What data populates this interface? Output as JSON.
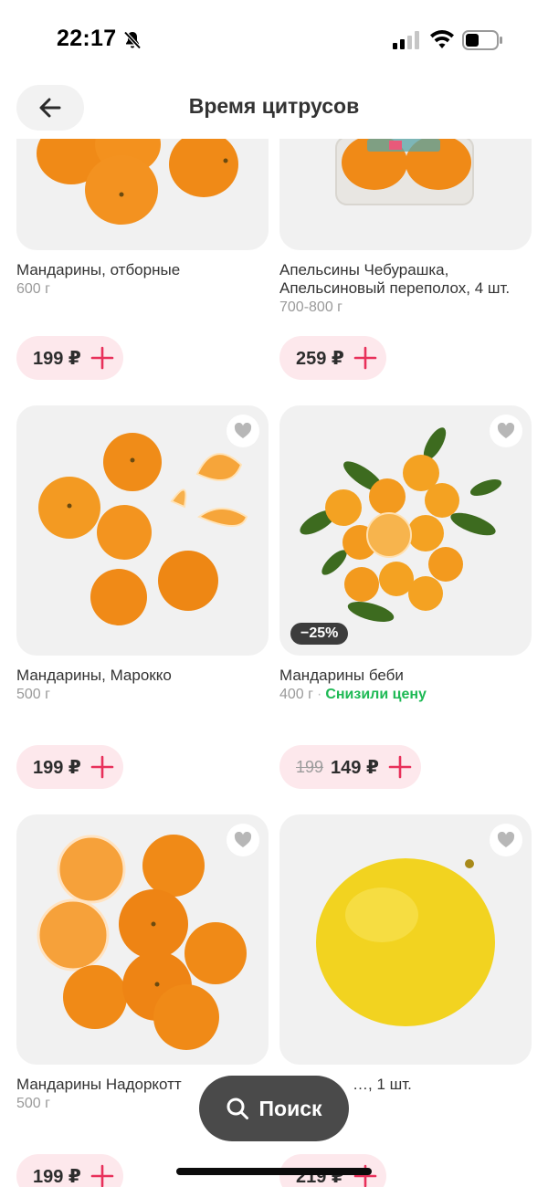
{
  "status_bar": {
    "time": "22:17",
    "icons": [
      "bell-slash-icon",
      "signal-icon",
      "wifi-icon",
      "battery-icon"
    ]
  },
  "header": {
    "back_icon": "arrow-left-icon",
    "title": "Время цитрусов"
  },
  "products": [
    {
      "name": "Мандарины, отборные",
      "weight": "600 г",
      "price": "199 ₽",
      "image": "tangerines-photo",
      "cropped": true
    },
    {
      "name": "Апельсины Чебурашка, Апельсиновый переполох, 4 шт.",
      "weight": "700-800 г",
      "price": "259 ₽",
      "image": "boxed-oranges-photo",
      "cropped": true
    },
    {
      "name": "Мандарины, Марокко",
      "weight": "500 г",
      "price": "199 ₽",
      "image": "tangerines-peeled-photo"
    },
    {
      "name": "Мандарины беби",
      "weight": "400 г",
      "promo": "Снизили цену",
      "old_price": "199",
      "price": "149 ₽",
      "discount": "−25%",
      "image": "baby-tangerines-leaves-photo"
    },
    {
      "name": "Мандарины Надоркотт",
      "weight": "500 г",
      "price": "199 ₽",
      "image": "nadorcott-tangerines-photo"
    },
    {
      "name": "…, 1 шт.",
      "weight": "",
      "price": "219 ₽",
      "image": "pomelo-photo"
    }
  ],
  "search": {
    "label": "Поиск",
    "icon": "search-icon"
  },
  "colors": {
    "price_pill_bg": "#fde8ec",
    "plus_accent": "#e8305a",
    "promo_green": "#1db954",
    "fab_bg": "#4a4a4a"
  }
}
